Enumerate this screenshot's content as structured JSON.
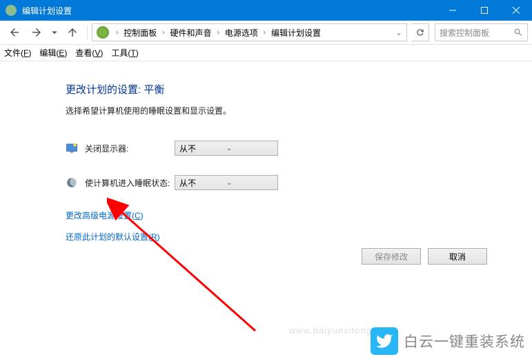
{
  "titlebar": {
    "title": "编辑计划设置"
  },
  "breadcrumb": {
    "items": [
      "控制面板",
      "硬件和声音",
      "电源选项",
      "编辑计划设置"
    ]
  },
  "search": {
    "placeholder": "搜索控制面板"
  },
  "menu": {
    "file": "文件(F)",
    "edit": "编辑(E)",
    "view": "查看(V)",
    "tools": "工具(T)"
  },
  "content": {
    "heading": "更改计划的设置: 平衡",
    "subtext": "选择希望计算机使用的睡眠设置和显示设置。",
    "display_off_label": "关闭显示器:",
    "display_off_value": "从不",
    "sleep_label": "使计算机进入睡眠状态:",
    "sleep_value": "从不"
  },
  "links": {
    "advanced": "更改高级电源设置(C)",
    "restore": "还原此计划的默认设置(R)"
  },
  "buttons": {
    "save": "保存修改",
    "cancel": "取消"
  },
  "watermark": {
    "text": "白云一键重装系统",
    "url": "www.baiyunxitong.com"
  }
}
